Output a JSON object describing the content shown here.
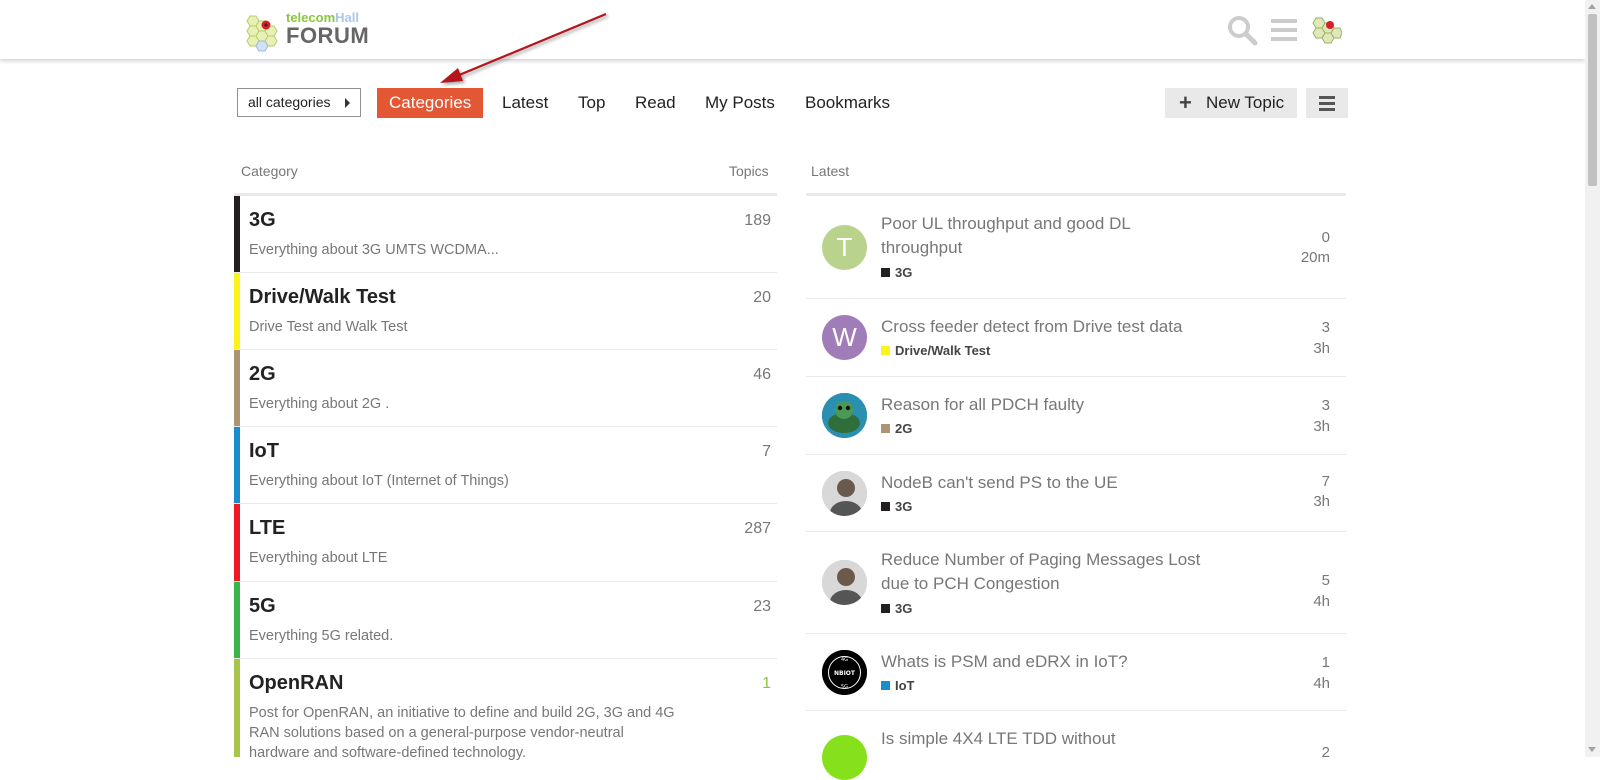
{
  "header": {
    "logo_top_a": "telecom",
    "logo_top_b": "Hall",
    "logo_bottom": "FORUM",
    "icons": [
      "search-icon",
      "hamburger-icon",
      "user-avatar-icon"
    ]
  },
  "nav": {
    "dropdown_label": "all categories",
    "items": [
      "Categories",
      "Latest",
      "Top",
      "Read",
      "My Posts",
      "Bookmarks"
    ],
    "active": "Categories",
    "new_topic_label": "New Topic"
  },
  "columns": {
    "category": "Category",
    "topics": "Topics",
    "latest": "Latest"
  },
  "categories": [
    {
      "name": "3G",
      "desc": "Everything about 3G UMTS WCDMA...",
      "count": "189",
      "color": "#231f20"
    },
    {
      "name": "Drive/Walk Test",
      "desc": "Drive Test and Walk Test",
      "count": "20",
      "color": "#fbf31c"
    },
    {
      "name": "2G",
      "desc": "Everything about 2G .",
      "count": "46",
      "color": "#ab9573"
    },
    {
      "name": "IoT",
      "desc": "Everything about IoT (Internet of Things)",
      "count": "7",
      "color": "#1a8dcf"
    },
    {
      "name": "LTE",
      "desc": "Everything about LTE",
      "count": "287",
      "color": "#ed1c24"
    },
    {
      "name": "5G",
      "desc": "Everything 5G related.",
      "count": "23",
      "color": "#3ab54a"
    },
    {
      "name": "OpenRAN",
      "desc": "Post for OpenRAN, an initiative to define and build 2G, 3G and 4G RAN solutions based on a general-purpose vendor-neutral hardware and software-defined technology.",
      "count": "1",
      "color": "#a9c44b"
    }
  ],
  "topics": [
    {
      "title": "Poor UL throughput and good DL throughput",
      "category": "3G",
      "cat_color": "#231f20",
      "replies": "0",
      "age": "20m",
      "avatar_letter": "T",
      "avatar_color": "#b9d28c"
    },
    {
      "title": "Cross feeder detect from Drive test data",
      "category": "Drive/Walk Test",
      "cat_color": "#fbf31c",
      "replies": "3",
      "age": "3h",
      "avatar_letter": "W",
      "avatar_color": "#a07cb8"
    },
    {
      "title": "Reason for all PDCH faulty",
      "category": "2G",
      "cat_color": "#ab9573",
      "replies": "3",
      "age": "3h",
      "avatar_letter": "",
      "avatar_color": "#1d6f8a"
    },
    {
      "title": "NodeB can't send PS to the UE",
      "category": "3G",
      "cat_color": "#231f20",
      "replies": "7",
      "age": "3h",
      "avatar_letter": "",
      "avatar_color": "#8a8a8a"
    },
    {
      "title": "Reduce Number of Paging Messages Lost due to PCH Congestion",
      "category": "3G",
      "cat_color": "#231f20",
      "replies": "5",
      "age": "4h",
      "avatar_letter": "",
      "avatar_color": "#8a8a8a"
    },
    {
      "title": "Whats is PSM and eDRX in IoT?",
      "category": "IoT",
      "cat_color": "#1a8dcf",
      "replies": "1",
      "age": "4h",
      "avatar_letter": "",
      "avatar_color": "#000000",
      "avatar_text": "4G NBIOT 5G"
    },
    {
      "title": "Is simple 4X4 LTE TDD without",
      "category": "",
      "cat_color": "#86e01b",
      "replies": "2",
      "age": "",
      "avatar_letter": "",
      "avatar_color": "#86e01b"
    }
  ],
  "accent_color": "#e45735"
}
